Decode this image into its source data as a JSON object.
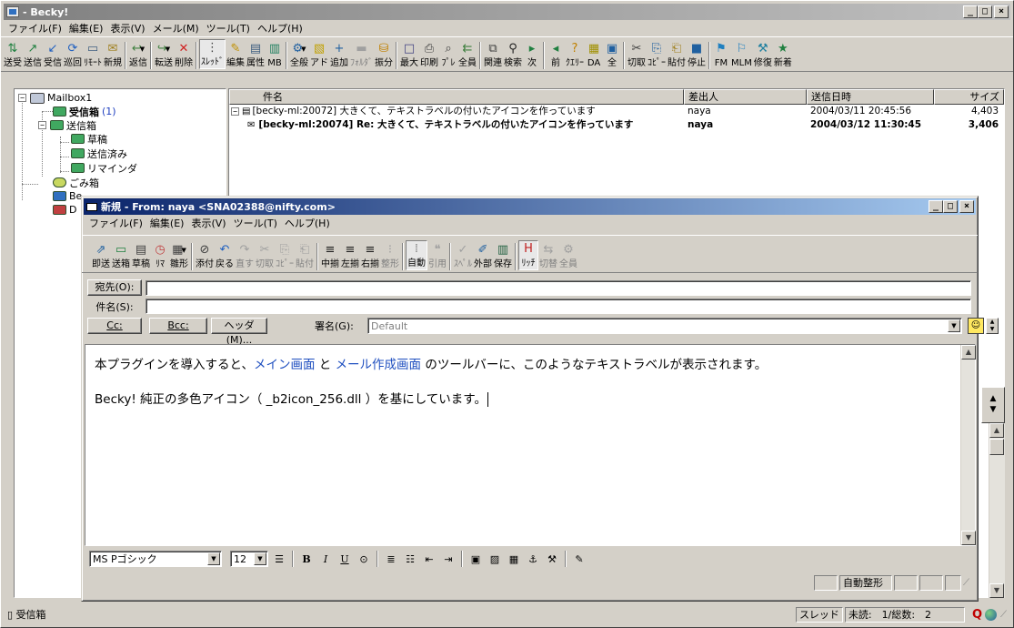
{
  "main_window": {
    "title": " - Becky!",
    "menu": [
      "ファイル(F)",
      "編集(E)",
      "表示(V)",
      "メール(M)",
      "ツール(T)",
      "ヘルプ(H)"
    ],
    "toolbar": [
      {
        "label": "送受",
        "icon": "send-receive-icon"
      },
      {
        "label": "送信",
        "icon": "send-icon"
      },
      {
        "label": "受信",
        "icon": "receive-icon"
      },
      {
        "label": "巡回",
        "icon": "patrol-icon"
      },
      {
        "label": "ﾘﾓｰﾄ",
        "icon": "remote-icon"
      },
      {
        "label": "新規",
        "icon": "new-mail-icon"
      },
      {
        "label": "返信",
        "icon": "reply-icon"
      },
      {
        "label": "転送",
        "icon": "forward-icon"
      },
      {
        "label": "削除",
        "icon": "delete-icon"
      },
      {
        "label": "ｽﾚｯﾄﾞ",
        "icon": "thread-icon"
      },
      {
        "label": "編集",
        "icon": "edit-icon"
      },
      {
        "label": "属性",
        "icon": "properties-icon"
      },
      {
        "label": "MB",
        "icon": "mailbox-icon"
      },
      {
        "label": "全般",
        "icon": "general-icon"
      },
      {
        "label": "アド",
        "icon": "address-book-icon"
      },
      {
        "label": "追加",
        "icon": "add-icon"
      },
      {
        "label": "ﾌｫﾙﾀﾞ",
        "icon": "folder-icon"
      },
      {
        "label": "振分",
        "icon": "filter-icon"
      },
      {
        "label": "最大",
        "icon": "maximize-icon"
      },
      {
        "label": "印刷",
        "icon": "print-icon"
      },
      {
        "label": "ﾌﾟﾚ",
        "icon": "preview-icon"
      },
      {
        "label": "全員",
        "icon": "reply-all-icon"
      },
      {
        "label": "関連",
        "icon": "related-icon"
      },
      {
        "label": "検索",
        "icon": "search-icon"
      },
      {
        "label": "次",
        "icon": "next-icon"
      },
      {
        "label": "前",
        "icon": "previous-icon"
      },
      {
        "label": "ｸｴﾘｰ",
        "icon": "query-icon"
      },
      {
        "label": "DA",
        "icon": "da-icon"
      },
      {
        "label": "全",
        "icon": "select-all-icon"
      },
      {
        "label": "切取",
        "icon": "cut-icon"
      },
      {
        "label": "ｺﾋﾟｰ",
        "icon": "copy-icon"
      },
      {
        "label": "貼付",
        "icon": "paste-icon"
      },
      {
        "label": "停止",
        "icon": "stop-icon"
      },
      {
        "label": "FM",
        "icon": "fm-icon"
      },
      {
        "label": "MLM",
        "icon": "mlm-icon"
      },
      {
        "label": "修復",
        "icon": "repair-icon"
      },
      {
        "label": "新着",
        "icon": "new-arrival-icon"
      }
    ],
    "tree": {
      "root": "Mailbox1",
      "inbox": "受信箱",
      "inbox_count": "(1)",
      "outbox": "送信箱",
      "drafts": "草稿",
      "sent": "送信済み",
      "reminder": "リマインダ",
      "trash": "ごみ箱",
      "partial1": "Be",
      "partial2": "D"
    },
    "list": {
      "columns": [
        "件名",
        "差出人",
        "送信日時",
        "サイズ"
      ],
      "rows": [
        {
          "subject": "[becky-ml:20072] 大きくて、テキストラベルの付いたアイコンを作っています",
          "from": "naya",
          "date": "2004/03/11 20:45:56",
          "size": "4,403"
        },
        {
          "subject": "[becky-ml:20074] Re: 大きくて、テキストラベルの付いたアイコンを作っています",
          "from": "naya",
          "date": "2004/03/12 11:30:45",
          "size": "3,406"
        }
      ]
    },
    "status": {
      "folder": "受信箱",
      "thread": "スレッド",
      "counts": "未読:　1/総数:　2"
    }
  },
  "compose": {
    "title": "新規 - From: naya <SNA02388@nifty.com>",
    "menu": [
      "ファイル(F)",
      "編集(E)",
      "表示(V)",
      "ツール(T)",
      "ヘルプ(H)"
    ],
    "toolbar": [
      {
        "label": "即送",
        "icon": "send-now-icon"
      },
      {
        "label": "送箱",
        "icon": "outbox-icon"
      },
      {
        "label": "草稿",
        "icon": "draft-icon"
      },
      {
        "label": "ﾘﾏ",
        "icon": "reminder-icon"
      },
      {
        "label": "雛形",
        "icon": "template-icon"
      },
      {
        "label": "添付",
        "icon": "attach-icon"
      },
      {
        "label": "戻る",
        "icon": "undo-icon"
      },
      {
        "label": "直す",
        "icon": "redo-icon"
      },
      {
        "label": "切取",
        "icon": "cut-icon"
      },
      {
        "label": "ｺﾋﾟｰ",
        "icon": "copy-icon"
      },
      {
        "label": "貼付",
        "icon": "paste-icon"
      },
      {
        "label": "中揃",
        "icon": "align-center-icon"
      },
      {
        "label": "左揃",
        "icon": "align-left-icon"
      },
      {
        "label": "右揃",
        "icon": "align-right-icon"
      },
      {
        "label": "整形",
        "icon": "format-icon"
      },
      {
        "label": "自動",
        "icon": "auto-format-icon"
      },
      {
        "label": "引用",
        "icon": "quote-icon"
      },
      {
        "label": "ｽﾍﾟﾙ",
        "icon": "spell-icon"
      },
      {
        "label": "外部",
        "icon": "external-editor-icon"
      },
      {
        "label": "保存",
        "icon": "save-icon"
      },
      {
        "label": "ﾘｯﾁ",
        "icon": "rich-text-icon"
      },
      {
        "label": "切替",
        "icon": "switch-icon"
      },
      {
        "label": "全員",
        "icon": "all-icon"
      }
    ],
    "to_label": "宛先(O):",
    "subject_label": "件名(S):",
    "cc_label": "Cc:",
    "bcc_label": "Bcc:",
    "header_btn": "ヘッダ(M)...",
    "signature_label": "署名(G):",
    "signature_value": "Default",
    "body_line1_a": "本プラグインを導入すると、",
    "body_line1_link1": "メイン画面",
    "body_line1_b": " と ",
    "body_line1_link2": "メール作成画面",
    "body_line1_c": " のツールバーに、このようなテキストラベルが表示されます。",
    "body_line2": "Becky! 純正の多色アイコン（ _b2icon_256.dll ）を基にしています。",
    "font_name": "MS Pゴシック",
    "font_size": "12",
    "status_autofmt": "自動整形"
  }
}
